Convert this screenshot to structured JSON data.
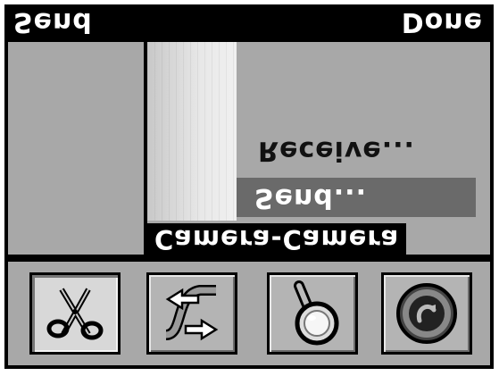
{
  "topbar": {
    "left_label": "Send",
    "right_label": "Done"
  },
  "list": {
    "items": [
      "Receive...",
      "Send..."
    ],
    "selected": "Send...",
    "title": "Camera-Camera"
  },
  "toolbar": {
    "buttons": [
      {
        "icon": "scissors-icon"
      },
      {
        "icon": "exchange-arrows-icon"
      },
      {
        "icon": "magnifier-icon"
      },
      {
        "icon": "power-icon"
      }
    ]
  },
  "colors": {
    "panel": "#a8a8a8",
    "highlight": "#6a6a6a",
    "bar": "#000000"
  }
}
